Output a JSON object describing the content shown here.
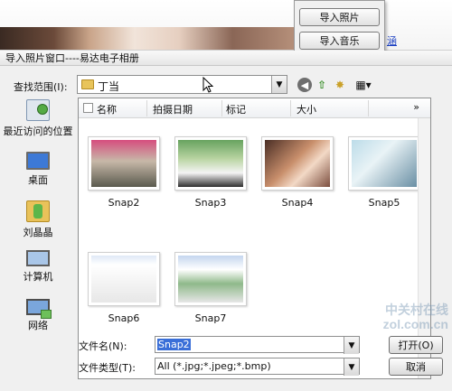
{
  "background_app": {
    "menu": [
      "导入照片",
      "导入音乐"
    ],
    "link_fragment": "涵"
  },
  "dialog": {
    "title": "导入照片窗口----易达电子相册",
    "look_in_label": "查找范围(I):",
    "look_in_value": "丁当",
    "toolbar": {
      "back_icon": "back-icon",
      "up_icon": "up-folder-icon",
      "new_folder_icon": "new-folder-icon",
      "views_icon": "views-menu-icon"
    },
    "places": [
      {
        "label": "最近访问的位置",
        "icon": "recent-places-icon"
      },
      {
        "label": "桌面",
        "icon": "desktop-icon"
      },
      {
        "label": "刘晶晶",
        "icon": "user-folder-icon"
      },
      {
        "label": "计算机",
        "icon": "computer-icon"
      },
      {
        "label": "网络",
        "icon": "network-icon"
      }
    ],
    "columns": [
      "名称",
      "拍摄日期",
      "标记",
      "大小"
    ],
    "more_columns": "»",
    "files": [
      {
        "name": "Snap2"
      },
      {
        "name": "Snap3"
      },
      {
        "name": "Snap4"
      },
      {
        "name": "Snap5"
      },
      {
        "name": "Snap6"
      },
      {
        "name": "Snap7"
      }
    ],
    "filename_label": "文件名(N):",
    "filename_value": "Snap2",
    "filetype_label": "文件类型(T):",
    "filetype_value": "All (*.jpg;*.jpeg;*.bmp)",
    "open_button": "打开(O)",
    "cancel_button": "取消"
  },
  "watermark": {
    "line1": "中关村在线",
    "line2": "zol.com.cn"
  }
}
